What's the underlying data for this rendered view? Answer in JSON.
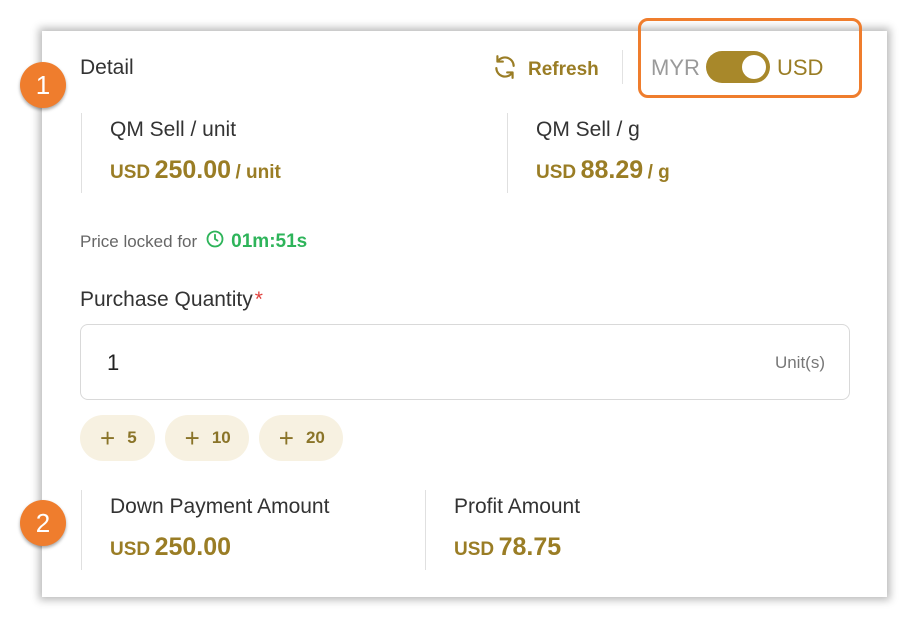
{
  "callouts": {
    "one": "1",
    "two": "2"
  },
  "header": {
    "title": "Detail",
    "refresh_label": "Refresh",
    "refresh_icon": "refresh-icon",
    "currency_left": "MYR",
    "currency_right": "USD",
    "toggle_state": "USD"
  },
  "prices": [
    {
      "label": "QM Sell / unit",
      "currency": "USD",
      "amount": "250.00",
      "unit": "/ unit"
    },
    {
      "label": "QM Sell / g",
      "currency": "USD",
      "amount": "88.29",
      "unit": "/ g"
    }
  ],
  "lock": {
    "text": "Price locked for",
    "icon": "clock-icon",
    "timer": "01m:51s"
  },
  "quantity": {
    "label": "Purchase Quantity",
    "required_mark": "*",
    "value": "1",
    "suffix": "Unit(s)",
    "increments": [
      "5",
      "10",
      "20"
    ]
  },
  "summary": [
    {
      "label": "Down Payment Amount",
      "currency": "USD",
      "amount": "250.00"
    },
    {
      "label": "Profit Amount",
      "currency": "USD",
      "amount": "78.75"
    }
  ],
  "colors": {
    "accent_gold": "#9a7d25",
    "toggle_gold": "#a8882a",
    "callout_orange": "#ef7d2d",
    "timer_green": "#2eb45a",
    "required_red": "#e0413d",
    "chip_bg": "#f7f1e1"
  }
}
